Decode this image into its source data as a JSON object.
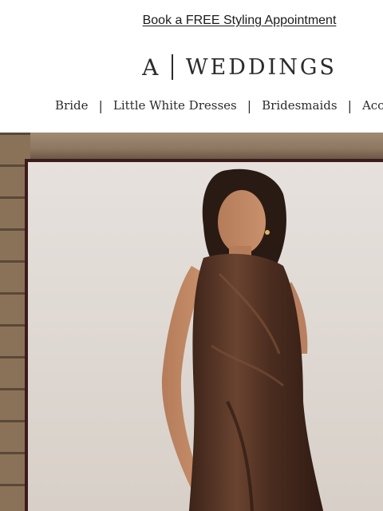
{
  "promo": {
    "text": "Book a FREE Styling Appointment"
  },
  "brand": {
    "mark": "A",
    "name": "WEDDINGS"
  },
  "nav": {
    "items": [
      {
        "label": "Bride"
      },
      {
        "label": "Little White Dresses"
      },
      {
        "label": "Bridesmaids"
      },
      {
        "label": "Acces"
      }
    ],
    "separator": "|"
  },
  "hero": {
    "image": "model-in-brown-satin-dress",
    "frame_color": "#3d1a1c"
  }
}
